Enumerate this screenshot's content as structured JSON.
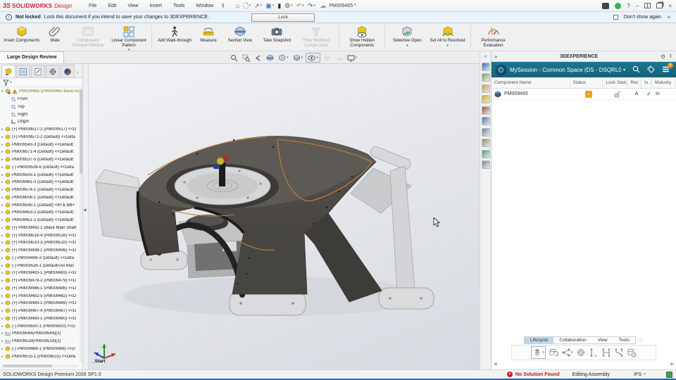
{
  "window": {
    "brand_prefix": "3S",
    "brand": "SOLIDWORKS",
    "brand_suffix": "Design",
    "title": "PM009465 *",
    "menus": [
      "File",
      "Edit",
      "View",
      "Insert",
      "Tools",
      "Window"
    ],
    "quick_access": [
      "home",
      "new-document",
      "open",
      "save",
      "rebuild-traffic-light",
      "options-gear",
      "undo",
      "redo"
    ],
    "controls": [
      "command-console",
      "connection-status",
      "help",
      "minimize",
      "split-view",
      "restore",
      "close"
    ]
  },
  "notification": {
    "state": "Not locked",
    "message": "Lock this document if you intend to save your changes to 3DEXPERIENCE.",
    "lock_button": "Lock",
    "dismiss_label": "Don't show again"
  },
  "ribbon": {
    "buttons": [
      {
        "label": "Insert Components",
        "icon": "insert-components"
      },
      {
        "label": "Mate",
        "icon": "mate"
      },
      {
        "label": "Component Preview Window",
        "icon": "component-preview",
        "disabled": true
      },
      {
        "label": "Linear Component Pattern",
        "icon": "linear-pattern",
        "dropdown": true
      },
      {
        "sep": true
      },
      {
        "label": "Add Walk-through",
        "icon": "walk-through"
      },
      {
        "label": "Measure",
        "icon": "measure"
      },
      {
        "label": "Section View",
        "icon": "section-view"
      },
      {
        "label": "Take Snapshot",
        "icon": "snapshot"
      },
      {
        "label": "Filter Modified Components",
        "icon": "filter-modified",
        "disabled": true
      },
      {
        "sep": true
      },
      {
        "label": "Show Hidden Components",
        "icon": "show-hidden"
      },
      {
        "sep": true
      },
      {
        "label": "Selective Open",
        "icon": "selective-open",
        "dropdown": true
      },
      {
        "label": "Set All to Resolved",
        "icon": "set-resolved",
        "dropdown": true
      },
      {
        "sep": true
      },
      {
        "label": "Performance Evaluation",
        "icon": "performance"
      }
    ]
  },
  "document_tab": {
    "label": "Large Design Review"
  },
  "headsup_toolbar": [
    {
      "icon": "zoom-to-fit"
    },
    {
      "icon": "zoom-to-area"
    },
    {
      "icon": "previous-view"
    },
    {
      "icon": "section-tool"
    },
    {
      "icon": "view-orientation",
      "dropdown": true
    },
    {
      "icon": "display-style",
      "dropdown": true
    },
    {
      "icon": "hide-show-items",
      "dropdown": true,
      "active": true
    },
    {
      "icon": "edit-appearance",
      "disabled": true
    },
    {
      "icon": "scene-settings",
      "disabled": true
    },
    {
      "icon": "view-settings",
      "dropdown": true
    }
  ],
  "feature_tree": {
    "tabs": [
      "assembly-manager",
      "property-manager",
      "configuration-manager",
      "dimxpert-manager",
      "display-manager"
    ],
    "root": "PM009465 (PM009465 Base Asser",
    "geometry": [
      "Front",
      "Top",
      "Right",
      "Origin"
    ],
    "items": [
      {
        "t": "(+) PM009517-2 (PM009517) <<D"
      },
      {
        "t": "(+) PM009572-2 (Default) <<Defa"
      },
      {
        "t": "PM009543-3 (Default) <<Default:"
      },
      {
        "t": "PM009571-4 (Default) <<Default:"
      },
      {
        "t": "PM009537-5 (Default) <<Default:"
      },
      {
        "t": "(-) PM009536-6 (Default) <<Defa"
      },
      {
        "t": "PM009505-1 (Default) <<Default:"
      },
      {
        "t": "PM009481-3 (Default) <<Default:"
      },
      {
        "t": "PM009574-1 (Default) <<Default:"
      },
      {
        "t": "PM009506-1 (Default) <<Default:"
      },
      {
        "t": "PM009545-1 (Default) <IH & BB>"
      },
      {
        "t": "PM009453-2 (Default) <<Default:"
      },
      {
        "t": "PM009451-2 (Default) <<Default:"
      },
      {
        "t": "(+) PM009492-1 (Base Main Shaft"
      },
      {
        "t": "(+) PM009516-4 (PM009516) <<D"
      },
      {
        "t": "(+) PM009510-3 (PM009510) <<D"
      },
      {
        "t": "(+) PM009498-1 (PM009498) <<D"
      },
      {
        "t": "(-) PM009496-3 (Default) <<Defa"
      },
      {
        "t": "(-) PM009526-1 (Default<As Mac"
      },
      {
        "t": "(+) PM009483-1 (PM009483) <<D"
      },
      {
        "t": "(+) PM009479-2 (PM009479) <<D"
      },
      {
        "t": "(+) PM009486-1 (PM009486) <<D"
      },
      {
        "t": "(+) PM009482-5 (PM009482) <<D"
      },
      {
        "t": "(+) PM009489-1 (PM009489) <<D"
      },
      {
        "t": "(+) PM009487-4 (PM009487) <<D"
      },
      {
        "t": "(+) PM009480-1 (PM009480) <<D"
      },
      {
        "t": "(-) PM009500-1 (PM009500) <<D"
      },
      {
        "t": "PM009544(PM009544)(2)",
        "folder": true
      },
      {
        "t": "PM009519(PM009519)(2)",
        "folder": true
      },
      {
        "t": "(-) PM009488-1 (PM009488) <<D"
      },
      {
        "t": "PM009515-1 (PM009515) <<Defa"
      }
    ]
  },
  "viewport": {
    "start_label": "_Start"
  },
  "task_pane": {
    "icons": [
      "3dexperience",
      "design-library",
      "file-explorer",
      "appearances",
      "scene-colors",
      "custom-properties",
      "screens",
      "parts-library",
      "sync",
      "add-contact"
    ]
  },
  "right_panel": {
    "header": "3DEXPERIENCE",
    "session": "MySession - Common Space (DS - DSQRL0...",
    "menu_badge": "4",
    "columns": [
      "Component Name",
      "Status",
      "Lock Status",
      "Rev",
      "Is ...",
      "Maturity"
    ],
    "rows": [
      {
        "name": "PM009465",
        "rev": "A",
        "maturity": "In",
        "checked": "✓"
      }
    ],
    "tabs": [
      "Lifecycle",
      "Collaboration",
      "View",
      "Tools"
    ],
    "active_tab": "Lifecycle",
    "tools": [
      "new-content",
      "revisions",
      "share",
      "routes",
      "versions",
      "branch",
      "merge",
      "history"
    ]
  },
  "status_bar": {
    "left": "SOLIDWORKS Design Premium 2026 SP1.0",
    "alert": "No Solution Found",
    "mode": "Editing Assembly",
    "units": "IPS"
  },
  "colors": {
    "accent_teal": "#1a7692",
    "alert_red": "#c01818",
    "warning_orange": "#f59d1e",
    "brand_red": "#d0202e"
  }
}
